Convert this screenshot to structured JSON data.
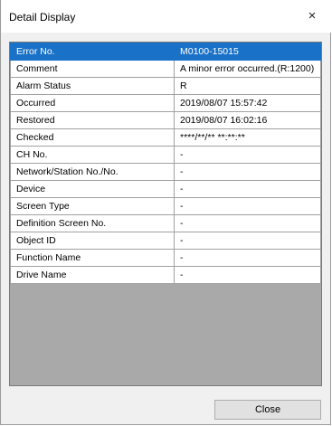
{
  "window": {
    "title": "Detail Display",
    "close_glyph": "×"
  },
  "rows": [
    {
      "label": "Error No.",
      "value": "M0100-15015"
    },
    {
      "label": "Comment",
      "value": "A minor error occurred.(R:1200)"
    },
    {
      "label": "Alarm Status",
      "value": "R"
    },
    {
      "label": "Occurred",
      "value": "2019/08/07 15:57:42"
    },
    {
      "label": "Restored",
      "value": "2019/08/07 16:02:16"
    },
    {
      "label": "Checked",
      "value": "****/**/** **:**:**"
    },
    {
      "label": "CH No.",
      "value": "-"
    },
    {
      "label": "Network/Station No./No.",
      "value": "-"
    },
    {
      "label": "Device",
      "value": "-"
    },
    {
      "label": "Screen Type",
      "value": "-"
    },
    {
      "label": "Definition Screen No.",
      "value": "-"
    },
    {
      "label": "Object ID",
      "value": "-"
    },
    {
      "label": "Function Name",
      "value": "-"
    },
    {
      "label": "Drive Name",
      "value": "-"
    }
  ],
  "buttons": {
    "close_label": "Close"
  }
}
